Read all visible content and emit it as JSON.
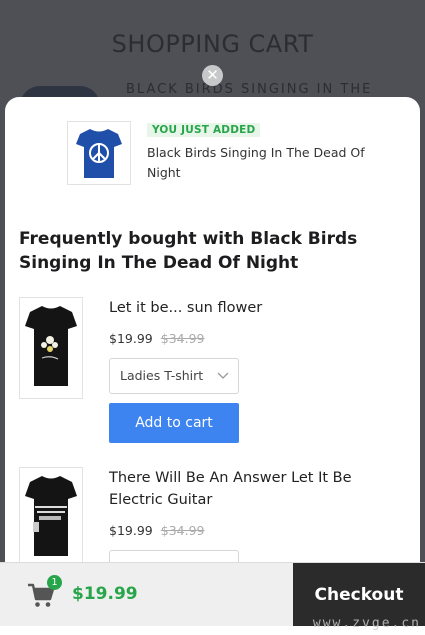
{
  "background": {
    "page_title": "SHOPPING CART",
    "product_name": "BLACK BIRDS SINGING IN THE"
  },
  "added": {
    "badge": "YOU JUST ADDED",
    "name": "Black Birds Singing In The Dead Of Night"
  },
  "frequently_bought": {
    "heading": "Frequently bought with Black Birds Singing In The Dead Of Night",
    "products": [
      {
        "name": "Let it be... sun flower",
        "price": "$19.99",
        "old_price": "$34.99",
        "variant": "Ladies T-shirt",
        "button": "Add to cart"
      },
      {
        "name": "There Will Be An Answer Let It Be Electric Guitar",
        "price": "$19.99",
        "old_price": "$34.99"
      }
    ]
  },
  "cart_bar": {
    "count": "1",
    "total": "$19.99",
    "checkout": "Checkout"
  },
  "watermark": "www.zvge.cn",
  "colors": {
    "accent_green": "#27a54a",
    "button_blue": "#3d84f0",
    "checkout_dark": "#2b2b2b"
  },
  "icons": [
    "close-icon",
    "chevron-down-icon",
    "cart-icon"
  ]
}
